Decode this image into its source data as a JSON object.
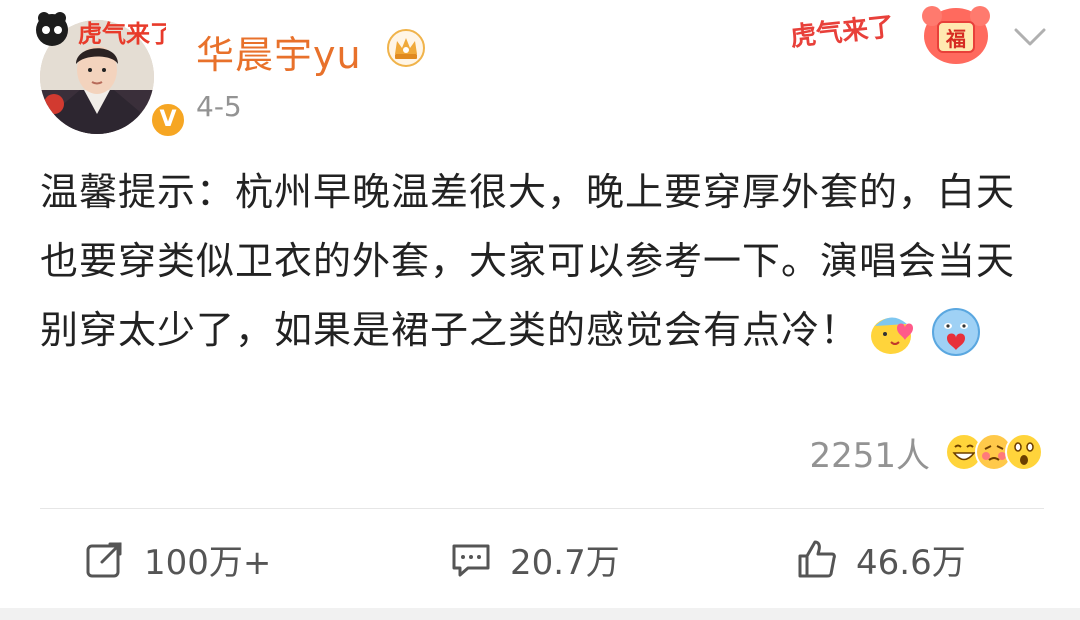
{
  "header": {
    "username": "华晨宇yu",
    "date": "4-5",
    "avatar_badge_text": "虎气来了",
    "festive_banner_text": "虎气来了",
    "festive_tag": "福",
    "verified_symbol": "V",
    "crown_icon": "crown-badge-icon",
    "more_icon": "chevron-down-icon"
  },
  "post": {
    "text": "温馨提示：杭州早晚温差很大，晚上要穿厚外套的，白天也要穿类似卫衣的外套，大家可以参考一下。演唱会当天别穿太少了，如果是裙子之类的感觉会有点冷！",
    "emojis": [
      "hug-emoji-icon",
      "heart-emoji-icon"
    ]
  },
  "reactions": {
    "count": "2251人",
    "faces": [
      "laugh-face-icon",
      "blush-face-icon",
      "surprised-face-icon"
    ]
  },
  "actions": {
    "repost": "100万+",
    "comment": "20.7万",
    "like": "46.6万"
  },
  "colors": {
    "username": "#e8712b",
    "meta_gray": "#939393",
    "verified": "#f6a623",
    "festive_red": "#e8403a"
  }
}
